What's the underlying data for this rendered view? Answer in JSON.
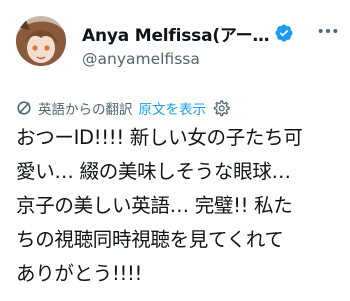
{
  "author": {
    "display_name": "Anya Melfissa(アー…",
    "handle": "@anyamelfissa",
    "verified": true,
    "avatar_icon": "avatar-image",
    "more_icon": "more-options-icon"
  },
  "translation": {
    "note": "英語からの翻訳",
    "show_original_label": "原文を表示",
    "icons": [
      "translate-icon",
      "gear-icon"
    ]
  },
  "tweet": {
    "text": "おつーID!!!! 新しい女の子たち可\n愛い… 綴の美味しそうな眼球…\n京子の美しい英語… 完璧!! 私た\nちの視聴同時視聴を見てくれて\nありがとう!!!!"
  },
  "colors": {
    "accent": "#1d9bf0",
    "secondary_text": "#536471",
    "primary_text": "#0f1419"
  }
}
